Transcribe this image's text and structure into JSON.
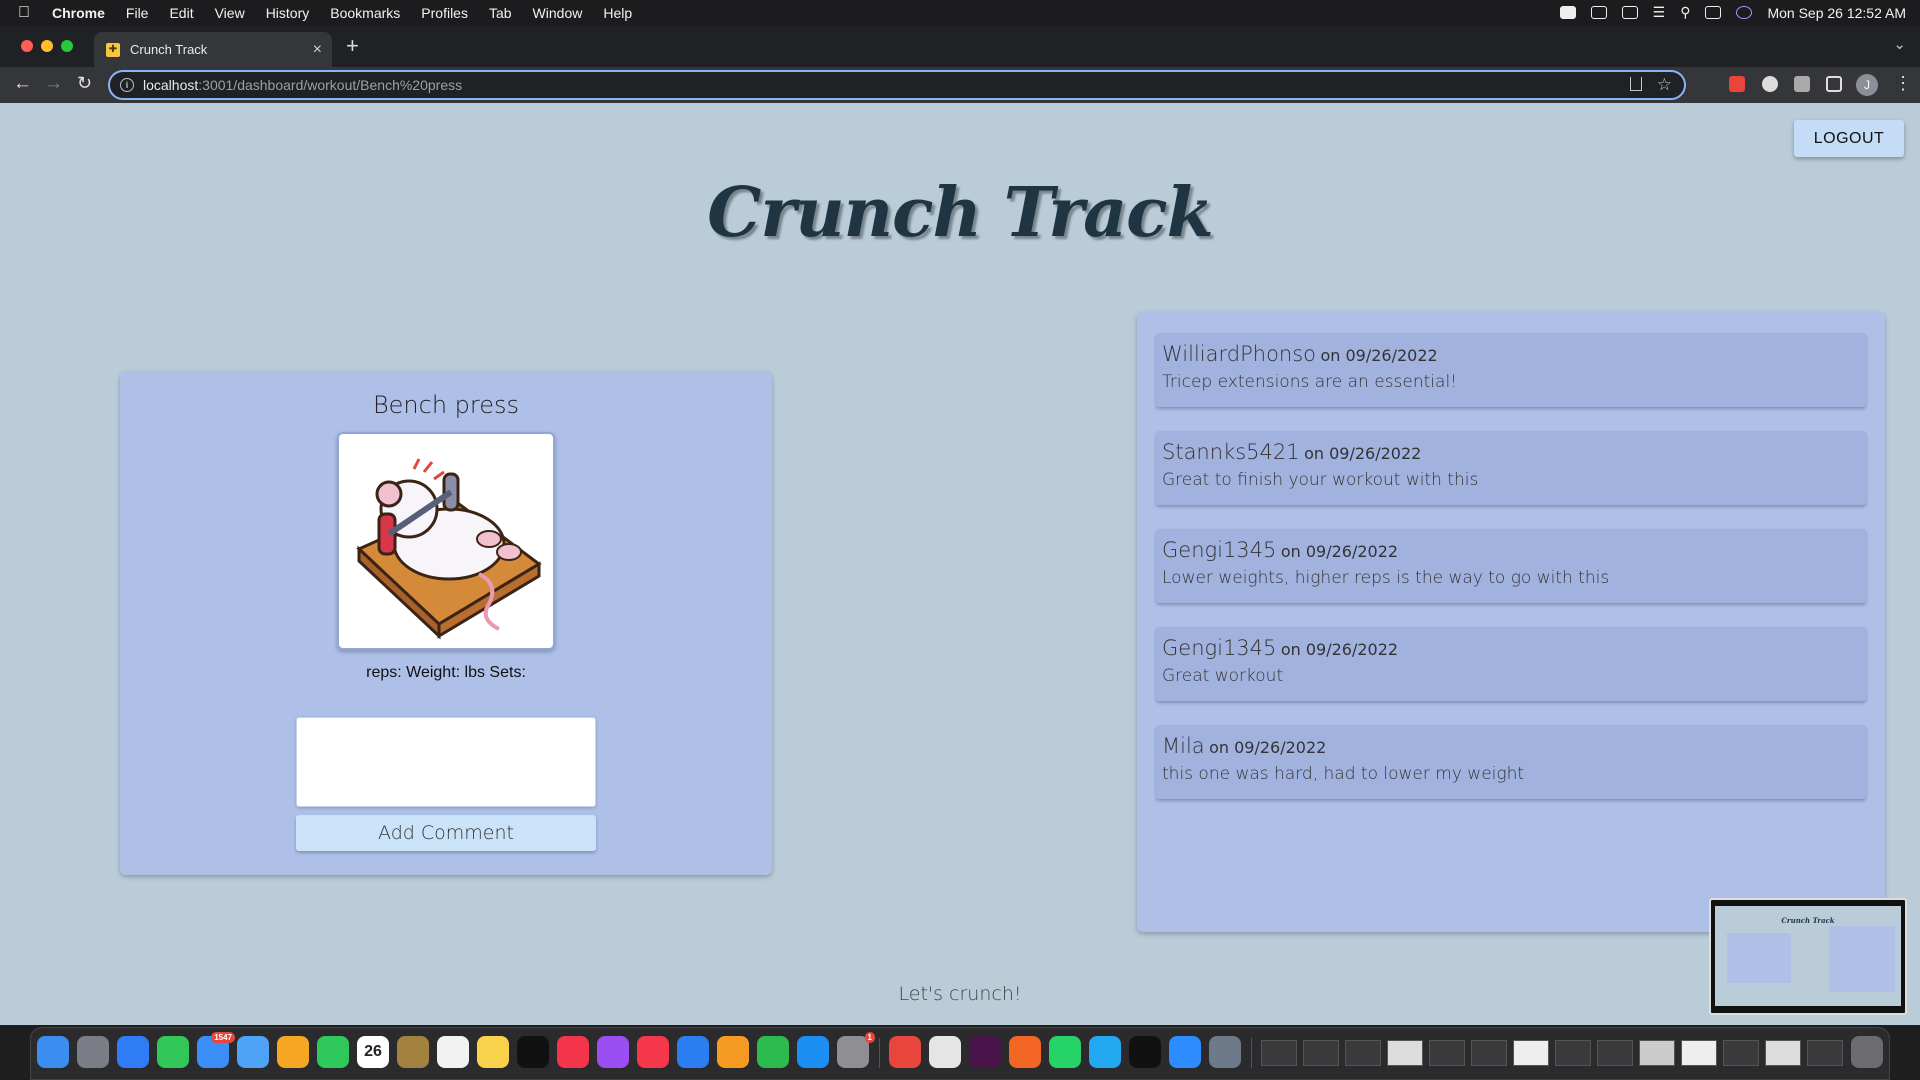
{
  "menubar": {
    "app": "Chrome",
    "items": [
      "File",
      "Edit",
      "View",
      "History",
      "Bookmarks",
      "Profiles",
      "Tab",
      "Window",
      "Help"
    ],
    "clock": "Mon Sep 26  12:52 AM"
  },
  "browser": {
    "tab_title": "Crunch Track",
    "url_host": "localhost",
    "url_rest": ":3001/dashboard/workout/Bench%20press",
    "profile_initial": "J"
  },
  "page": {
    "logout_label": "LOGOUT",
    "app_title": "Crunch Track",
    "footer": "Let's crunch!",
    "pip_title": "Crunch Track"
  },
  "workout": {
    "name": "Bench press",
    "stats": "reps: Weight: lbs Sets:",
    "comment_placeholder": "",
    "add_comment_label": "Add Comment"
  },
  "comments": [
    {
      "user": "WilliardPhonso",
      "date": "on 09/26/2022",
      "text": "Tricep extensions are an essential!"
    },
    {
      "user": "Stannks5421",
      "date": "on 09/26/2022",
      "text": "Great to finish your workout with this"
    },
    {
      "user": "Gengi1345",
      "date": "on 09/26/2022",
      "text": "Lower weights, higher reps is the way to go with this"
    },
    {
      "user": "Gengi1345",
      "date": "on 09/26/2022",
      "text": "Great workout"
    },
    {
      "user": "Mila",
      "date": "on 09/26/2022",
      "text": "this one was hard, had to lower my weight"
    }
  ],
  "dock": {
    "calendar_day": "26",
    "mail_badge": "1547",
    "settings_badge": "1"
  },
  "colors": {
    "page_bg": "#b9ccd8",
    "card_bg": "#aec0e8",
    "comment_bg": "#a2b2df",
    "title": "#1f3544",
    "button": "#cbe3f8"
  }
}
